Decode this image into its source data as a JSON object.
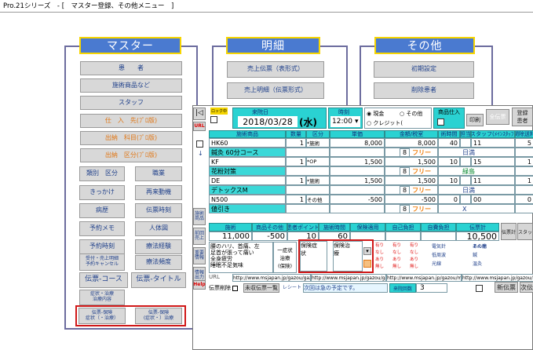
{
  "window": {
    "title": "Pro.21シリーズ　- [　マスター登録、その他メニュー　]"
  },
  "sections": {
    "master": "マスター",
    "detail": "明細",
    "other": "その他"
  },
  "master_buttons": {
    "patient": "患　　者",
    "treatment": "施術商品など",
    "staff": "スタッフ",
    "supplier": "仕　入　先(ﾌﾟﾛ版)",
    "outgoing": "出納　科目(ﾌﾟﾛ版)",
    "outgoing_class": "出納　区分(ﾌﾟﾛ版)",
    "category": "類別　区分",
    "occupation": "職業",
    "trigger": "きっかけ",
    "revisit": "再来動機",
    "history": "病歴",
    "slip_time": "伝票時刻",
    "reserve_memo": "予約メモ",
    "body_chart": "人体図",
    "reserve_time": "予約時刻",
    "treat_exp": "療法経験",
    "reception_1": "受付・売上明細",
    "reception_2": "予約キャンセル",
    "treat_freq": "療法頻度",
    "slip_course": "伝票-コース",
    "slip_title": "伝票-タイトル",
    "symptom_1": "症状・治療",
    "symptom_2": "治療内容",
    "ins1_1": "伝票-保険",
    "ins1_2": "症状（・治療）",
    "ins2_1": "伝票-保険",
    "ins2_2": "(症状・）治療"
  },
  "detail_buttons": {
    "sales_slip": "売上伝票（表形式）",
    "sales_detail": "売上明細（伝票形式）"
  },
  "other_buttons": {
    "initial": "初期設定",
    "delete_patient": "削除患者"
  },
  "slip": {
    "status": "ロック中",
    "date_label": "来院日",
    "date": "2018/03/28",
    "weekday": "(水)",
    "time_label": "時刻",
    "time": "12:00",
    "cash": "現金",
    "credit": "クレジット(",
    "other": "その他",
    "goods_in": "商品仕入",
    "btn_print": "印刷",
    "btn_total": "全伝票",
    "btn_label": "登録",
    "btn_label2": "患者",
    "url_tag": "URL",
    "headers": [
      "施術商品",
      "数量",
      "区分",
      "単価",
      "金額/税室",
      "術時間",
      "担当",
      "スタッフ(ﾒｲﾝｽﾀｯﾌ)",
      "関除送料"
    ],
    "rows": [
      {
        "name": "HK60",
        "qty": "1",
        "kind": "*施術",
        "price": "8,000",
        "amount": "8,000",
        "time": "40",
        "mm": "11",
        "staff": "",
        "no": "5",
        "sub": "",
        "tax": "8",
        "free": "フリー",
        "staffname": "日満"
      },
      {
        "name": "鍼灸 60分コース",
        "qty": "",
        "kind": "",
        "price": "",
        "amount": "",
        "time": "",
        "mm": "",
        "staff": "",
        "no": "",
        "sub": "",
        "tax": "8",
        "free": "フリー",
        "staffname": "日満"
      },
      {
        "name": "KF",
        "qty": "1",
        "kind": "*OP",
        "price": "1,500",
        "amount": "1,500",
        "time": "10",
        "mm": "15",
        "staff": "",
        "no": "1",
        "sub": "",
        "tax": "8",
        "free": "フリー",
        "staffname": "緑島"
      },
      {
        "name": "花粉対策",
        "qty": "",
        "kind": "",
        "price": "",
        "amount": "",
        "time": "",
        "mm": "",
        "staff": "",
        "no": "",
        "sub": "",
        "tax": "8",
        "free": "フリー",
        "staffname": "緑島"
      },
      {
        "name": "DE",
        "qty": "1",
        "kind": "*施術",
        "price": "1,500",
        "amount": "1,500",
        "time": "10",
        "mm": "11",
        "staff": "",
        "no": "1",
        "sub": "",
        "tax": "8",
        "free": "フリー",
        "staffname": "日満"
      },
      {
        "name": "デトックスM",
        "qty": "",
        "kind": "",
        "price": "",
        "amount": "",
        "time": "",
        "mm": "",
        "staff": "",
        "no": "",
        "sub": "",
        "tax": "8",
        "free": "フリー",
        "staffname": "日満"
      },
      {
        "name": "N500",
        "qty": "1",
        "kind": "その他",
        "price": "-500",
        "amount": "-500",
        "time": "0",
        "mm": "00",
        "staff": "",
        "no": "0",
        "sub": "",
        "tax": "8",
        "free": "フリー",
        "staffname": "X"
      },
      {
        "name": "値引き",
        "qty": "",
        "kind": "",
        "price": "",
        "amount": "",
        "time": "",
        "mm": "",
        "staff": "",
        "no": "",
        "sub": "",
        "tax": "8",
        "free": "フリー",
        "staffname": "X"
      }
    ],
    "total_headers": [
      "施術",
      "商品その他",
      "患者ポイント",
      "施術時間",
      "保険適用",
      "自己負担",
      "自費負担",
      "伝票計"
    ],
    "totals": {
      "treat": "11,000",
      "goods": "-500",
      "point": "10",
      "time": "60",
      "ins": "",
      "self": "",
      "selfpay": "",
      "slip": "10,500"
    },
    "memo": "腰のハリ、首痛、左\n足首が張って痛い\n全身疲労\n睡眠不足気味",
    "ins_sym": "保険症\n状",
    "ins_treat": "保険治\n療",
    "treat_label": "施術",
    "other_label": "一症状\n治療\n(保険)",
    "urls": [
      "http://www.msjapan.jp/gazou/gazou",
      "http://www.msjapan.jp/gazou/gazou",
      "http://www.msjapan.jp/gazou/mmilk",
      "http://www.msjapan.jp/gazou/gazou"
    ],
    "bottom": {
      "slip_delete": "伝票削除",
      "unsettled": "未収伝票一覧",
      "receipt": "レシート",
      "reserve_msg": "次回は急の予定です。",
      "visit_count": "来院回数",
      "count": "3",
      "new": "新伝票",
      "next": "次伝"
    },
    "side_labels": [
      "URL",
      "施術\n商品",
      "前回\n売上",
      "重要\n情報",
      "情報\n出力",
      "Help"
    ],
    "opts": [
      "有り",
      "なし",
      "あり",
      "無し"
    ],
    "mini": [
      "電気針",
      "低周波",
      "光線",
      "あん摩",
      "鍼",
      "温灸",
      "その他"
    ]
  }
}
